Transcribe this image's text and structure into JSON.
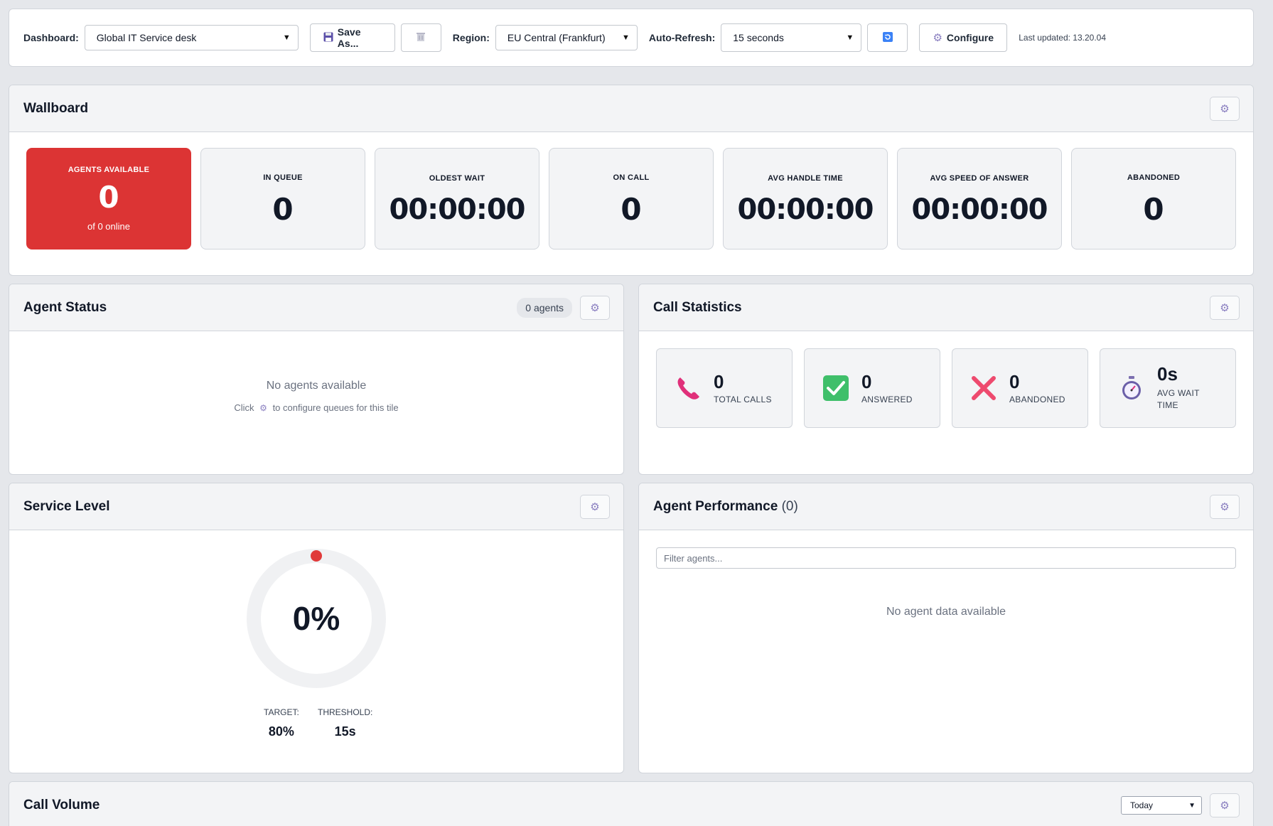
{
  "toolbar": {
    "dashboard_label": "Dashboard:",
    "dashboard_value": "Global IT Service desk",
    "save_as_label": "Save As...",
    "region_label": "Region:",
    "region_value": "EU Central (Frankfurt)",
    "autorefresh_label": "Auto-Refresh:",
    "autorefresh_value": "15 seconds",
    "configure_label": "Configure",
    "last_updated": "Last updated: 13.20.04"
  },
  "wallboard": {
    "title": "Wallboard",
    "agents_available": {
      "label": "AGENTS AVAILABLE",
      "value": "0",
      "sub": "of 0 online"
    },
    "in_queue": {
      "label": "IN QUEUE",
      "value": "0"
    },
    "oldest_wait": {
      "label": "OLDEST WAIT",
      "value": "00:00:00"
    },
    "on_call": {
      "label": "ON CALL",
      "value": "0"
    },
    "avg_handle_time": {
      "label": "AVG HANDLE TIME",
      "value": "00:00:00"
    },
    "avg_speed_of_answer": {
      "label": "AVG SPEED OF ANSWER",
      "value": "00:00:00"
    },
    "abandoned": {
      "label": "ABANDONED",
      "value": "0"
    }
  },
  "agent_status": {
    "title": "Agent Status",
    "badge": "0 agents",
    "empty_title": "No agents available",
    "empty_sub_pre": "Click",
    "empty_sub_post": "to configure queues for this tile"
  },
  "call_statistics": {
    "title": "Call Statistics",
    "items": [
      {
        "value": "0",
        "label": "TOTAL CALLS",
        "icon": "phone-icon"
      },
      {
        "value": "0",
        "label": "ANSWERED",
        "icon": "check-icon"
      },
      {
        "value": "0",
        "label": "ABANDONED",
        "icon": "cross-icon"
      },
      {
        "value": "0s",
        "label": "AVG WAIT TIME",
        "icon": "stopwatch-icon"
      }
    ]
  },
  "service_level": {
    "title": "Service Level",
    "percent": "0%",
    "target_label": "TARGET:",
    "target_value": "80%",
    "threshold_label": "THRESHOLD:",
    "threshold_value": "15s"
  },
  "agent_performance": {
    "title": "Agent Performance",
    "count": "(0)",
    "filter_placeholder": "Filter agents...",
    "empty": "No agent data available"
  },
  "call_volume": {
    "title": "Call Volume",
    "range_value": "Today"
  },
  "colors": {
    "alert": "#dc3434",
    "accent": "#2563eb",
    "gauge_dot": "#e03a3a"
  }
}
